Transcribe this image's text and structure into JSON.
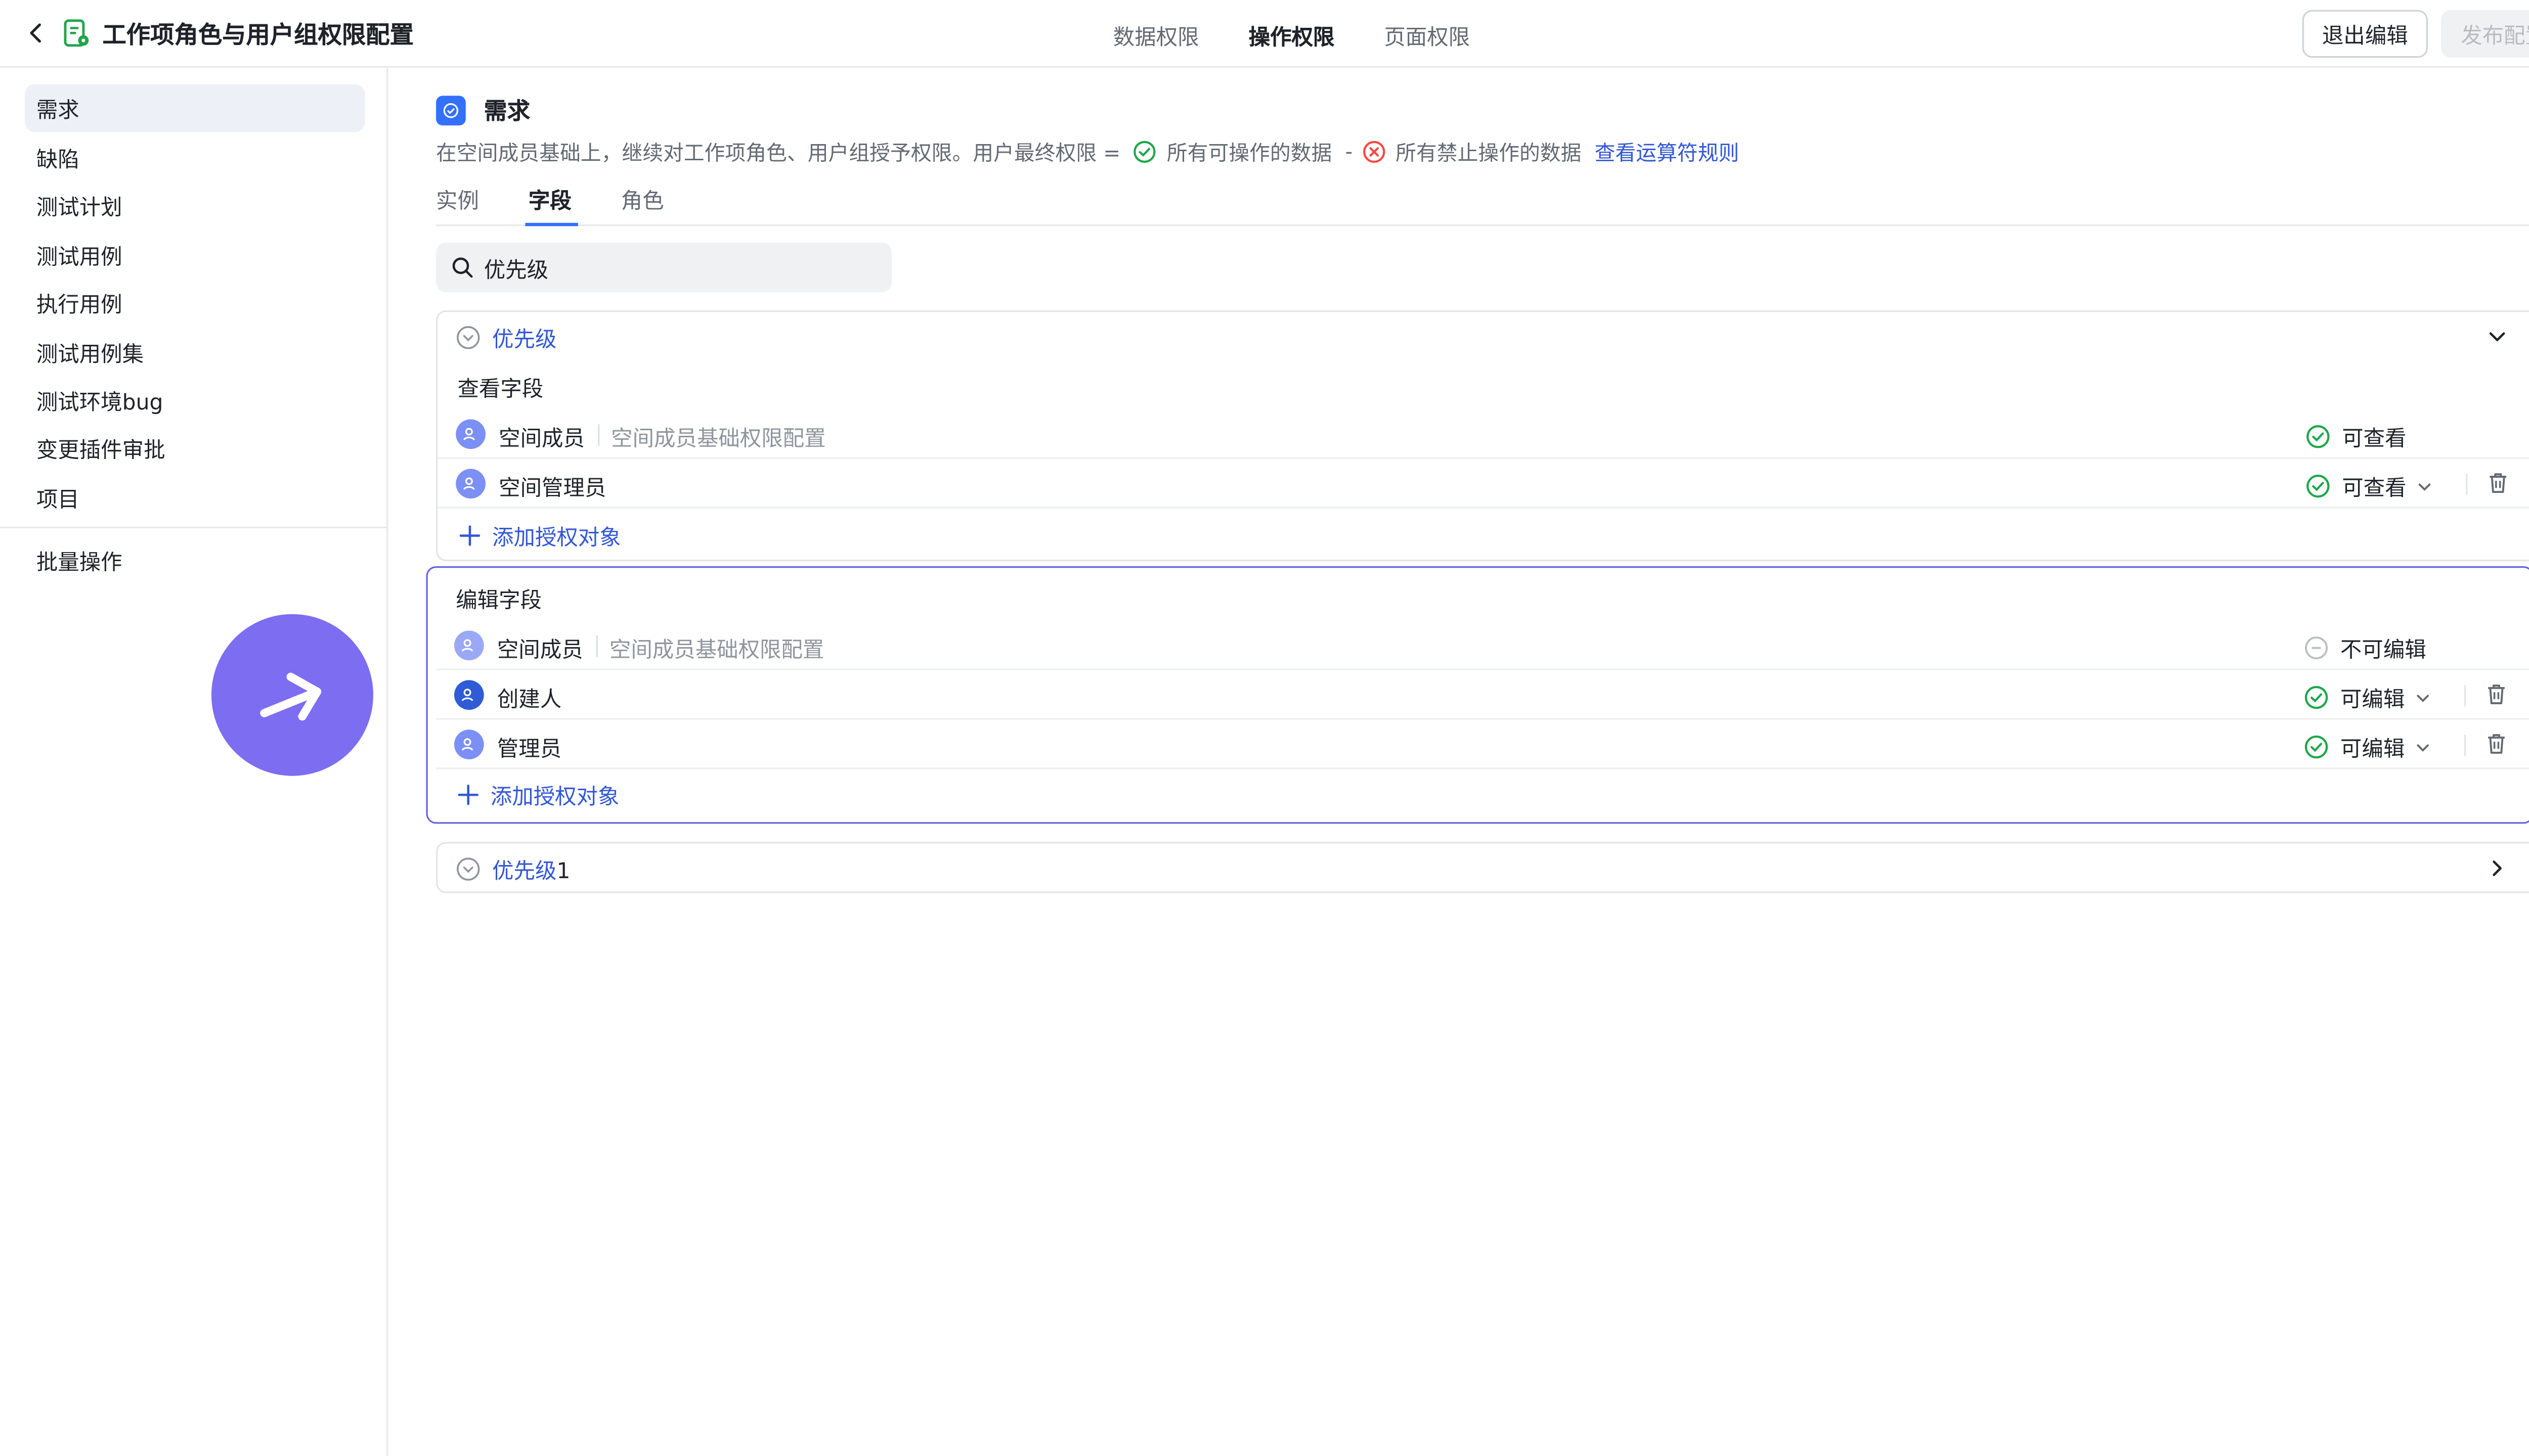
{
  "header": {
    "title": "工作项角色与用户组权限配置",
    "tabs": [
      {
        "label": "数据权限",
        "active": false
      },
      {
        "label": "操作权限",
        "active": true
      },
      {
        "label": "页面权限",
        "active": false
      }
    ],
    "exit_label": "退出编辑",
    "publish_label": "发布配置"
  },
  "sidebar": {
    "items": [
      {
        "label": "需求",
        "active": true
      },
      {
        "label": "缺陷"
      },
      {
        "label": "测试计划"
      },
      {
        "label": "测试用例"
      },
      {
        "label": "执行用例"
      },
      {
        "label": "测试用例集"
      },
      {
        "label": "测试环境bug"
      },
      {
        "label": "变更插件审批"
      },
      {
        "label": "项目"
      }
    ],
    "batch_label": "批量操作"
  },
  "main": {
    "section_title": "需求",
    "description": "在空间成员基础上，继续对工作项角色、用户组授予权限。用户最终权限 =",
    "allowed_label": "所有可操作的数据",
    "minus": "-",
    "denied_label": "所有禁止操作的数据",
    "rules_link": "查看运算符规则",
    "tabs": [
      {
        "label": "实例"
      },
      {
        "label": "字段",
        "active": true
      },
      {
        "label": "角色"
      }
    ],
    "search_value": "优先级",
    "cards": [
      {
        "title": "优先级",
        "view_group": {
          "label": "查看字段",
          "rows": [
            {
              "name": "空间成员",
              "desc": "空间成员基础权限配置",
              "perm": "可查看"
            },
            {
              "name": "空间管理员",
              "perm": "可查看"
            }
          ],
          "add_label": "添加授权对象"
        },
        "edit_group": {
          "label": "编辑字段",
          "rows": [
            {
              "name": "空间成员",
              "desc": "空间成员基础权限配置",
              "perm": "不可编辑"
            },
            {
              "name": "创建人",
              "perm": "可编辑"
            },
            {
              "name": "管理员",
              "perm": "可编辑"
            }
          ],
          "add_label": "添加授权对象"
        }
      },
      {
        "title_prefix": "优先级",
        "title_suffix": "1"
      }
    ]
  },
  "colors": {
    "accent": "#3370ff",
    "link": "#3257d6",
    "success": "#1fa64b",
    "danger": "#f54a45",
    "fab": "#7c6df1"
  }
}
